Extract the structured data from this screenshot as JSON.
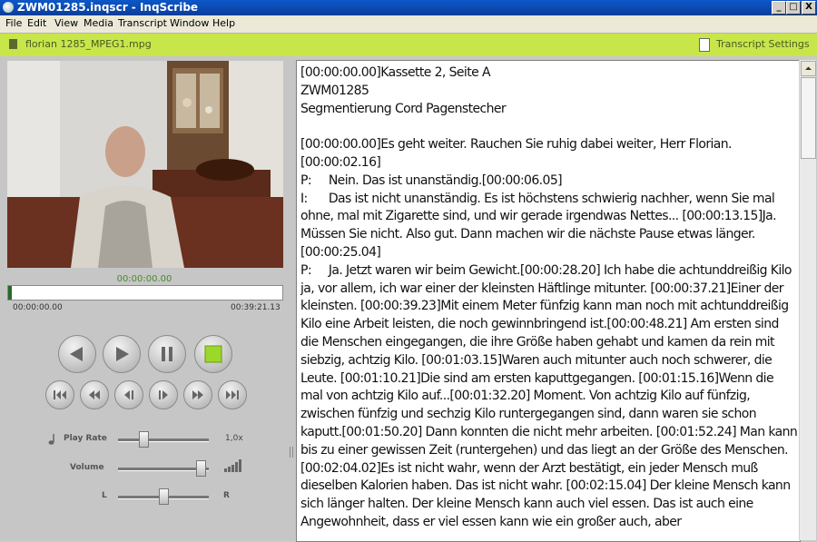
{
  "window": {
    "title": "ZWM01285.inqscr - InqScribe",
    "min": "_",
    "max": "□",
    "close": "X"
  },
  "menu": [
    "File",
    "Edit",
    "View",
    "Media",
    "Transcript",
    "Window",
    "Help"
  ],
  "media": {
    "filename": "florian 1285_MPEG1.mpg"
  },
  "settings": {
    "label": "Transcript Settings"
  },
  "player": {
    "current_time": "00:00:00.00",
    "start_time": "00:00:00.00",
    "end_time": "00:39:21.13",
    "play_rate_label": "Play Rate",
    "play_rate_value": "1,0x",
    "volume_label": "Volume",
    "balance_left": "L",
    "balance_right": "R",
    "progress": 0.0,
    "play_rate_level": 0.25,
    "volume_level": 0.95,
    "balance_level": 0.5
  },
  "transcript": {
    "text": "[00:00:00.00]Kassette 2, Seite A\nZWM01285\nSegmentierung Cord Pagenstecher\n\n[00:00:00.00]Es geht weiter. Rauchen Sie ruhig dabei weiter, Herr Florian. [00:00:02.16]\nP:\tNein. Das ist unanständig.[00:00:06.05]\nI:\tDas ist nicht unanständig. Es ist höchstens schwierig nachher, wenn Sie mal ohne, mal mit Zigarette sind, und wir gerade irgendwas Nettes... [00:00:13.15]Ja. Müssen Sie nicht. Also gut. Dann machen wir die nächste Pause etwas länger. [00:00:25.04]\nP:\tJa. Jetzt waren wir beim Gewicht.[00:00:28.20] Ich habe die achtunddreißig Kilo ja, vor allem, ich war einer der kleinsten Häftlinge mitunter. [00:00:37.21]Einer der kleinsten. [00:00:39.23]Mit einem Meter fünfzig kann man noch mit achtunddreißig Kilo eine Arbeit leisten, die noch gewinnbringend ist.[00:00:48.21] Am ersten sind die Menschen eingegangen, die ihre Größe haben gehabt und kamen da rein mit siebzig, achtzig Kilo. [00:01:03.15]Waren auch mitunter auch noch schwerer, die Leute. [00:01:10.21]Die sind am ersten kaputtgegangen. [00:01:15.16]Wenn die mal von achtzig Kilo auf...[00:01:32.20] Moment. Von achtzig Kilo auf fünfzig, zwischen fünfzig und sechzig Kilo runtergegangen sind, dann waren sie schon kaputt.[00:01:50.20] Dann konnten die nicht mehr arbeiten. [00:01:52.24] Man kann bis zu einer gewissen Zeit (runtergehen) und das liegt an der Größe des Menschen. [00:02:04.02]Es ist nicht wahr, wenn der Arzt bestätigt, ein jeder Mensch muß dieselben Kalorien haben. Das ist nicht wahr. [00:02:15.04] Der kleine Mensch kann sich länger halten. Der kleine Mensch kann auch viel essen. Das ist auch eine Angewohnheit, dass er viel essen kann wie ein großer auch, aber"
  },
  "icons": {
    "rewind": "rewind-icon",
    "play": "play-icon",
    "pause": "pause-icon",
    "stop": "stop-icon",
    "go_start": "skip-to-start-icon",
    "fast_back": "fast-backward-icon",
    "step_back": "step-back-icon",
    "step_fwd": "step-forward-icon",
    "fast_fwd": "fast-forward-icon",
    "go_end": "skip-to-end-icon",
    "play_rate": "note-icon",
    "volume": "volume-bars-icon"
  },
  "colors": {
    "accent": "#c8e64a",
    "stop": "#9bd82a",
    "title_bar": "#0a4bb8"
  }
}
